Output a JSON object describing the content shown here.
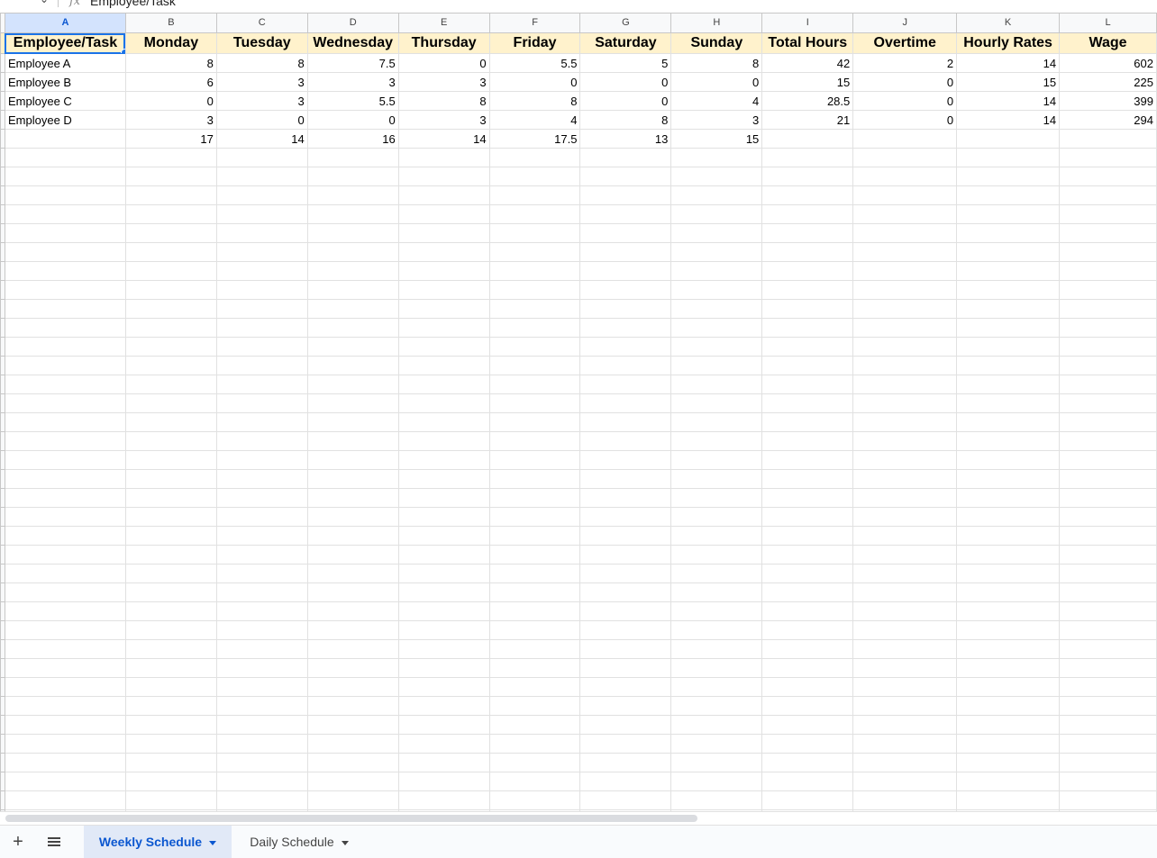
{
  "formula_bar": {
    "fx_icon": "fx-icon",
    "value": "Employee/Task"
  },
  "columns": [
    "A",
    "B",
    "C",
    "D",
    "E",
    "F",
    "G",
    "H",
    "I",
    "J",
    "K",
    "L"
  ],
  "headers": [
    "Employee/Task",
    "Monday",
    "Tuesday",
    "Wednesday",
    "Thursday",
    "Friday",
    "Saturday",
    "Sunday",
    "Total Hours",
    "Overtime",
    "Hourly Rates",
    "Wage"
  ],
  "rows": [
    [
      "Employee A",
      "8",
      "8",
      "7.5",
      "0",
      "5.5",
      "5",
      "8",
      "42",
      "2",
      "14",
      "602"
    ],
    [
      "Employee B",
      "6",
      "3",
      "3",
      "3",
      "0",
      "0",
      "0",
      "15",
      "0",
      "15",
      "225"
    ],
    [
      "Employee C",
      "0",
      "3",
      "5.5",
      "8",
      "8",
      "0",
      "4",
      "28.5",
      "0",
      "14",
      "399"
    ],
    [
      "Employee D",
      "3",
      "0",
      "0",
      "3",
      "4",
      "8",
      "3",
      "21",
      "0",
      "14",
      "294"
    ],
    [
      "",
      "17",
      "14",
      "16",
      "14",
      "17.5",
      "13",
      "15",
      "",
      "",
      "",
      ""
    ]
  ],
  "active_cell": "A1",
  "colors": {
    "header_fill": "#fff2cc",
    "selection": "#1a73e8",
    "active_tab_text": "#0b57d0"
  },
  "sheet_tabs": [
    {
      "label": "Weekly Schedule",
      "active": true
    },
    {
      "label": "Daily Schedule",
      "active": false
    }
  ],
  "tabbar_icons": {
    "add": "plus-icon",
    "all_sheets": "menu-icon"
  }
}
